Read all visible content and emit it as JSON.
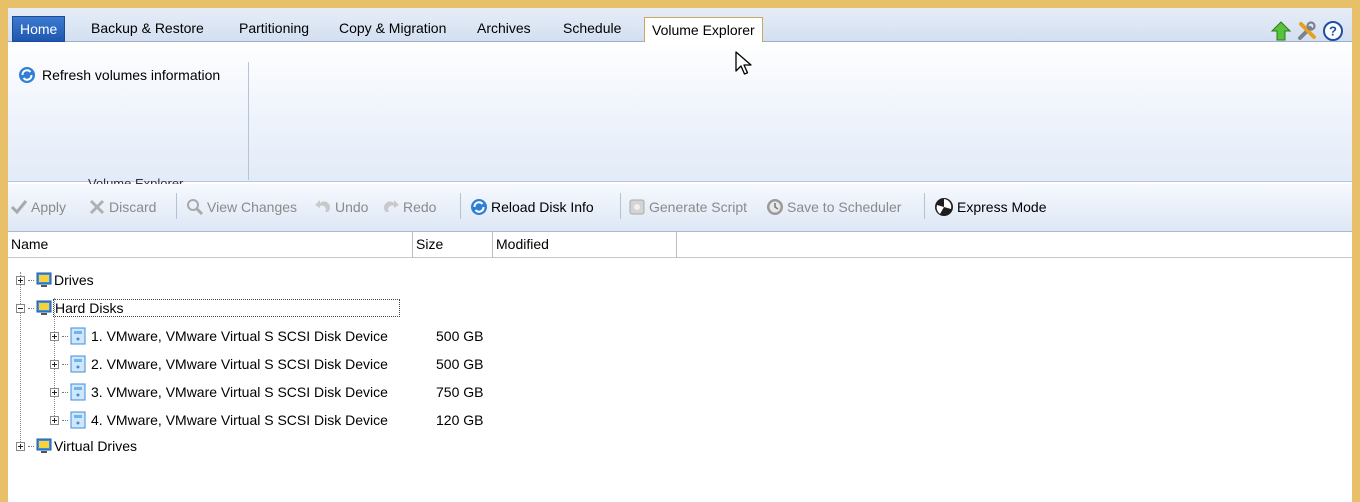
{
  "tabs": [
    "Home",
    "Backup & Restore",
    "Partitioning",
    "Copy & Migration",
    "Archives",
    "Schedule",
    "Volume Explorer"
  ],
  "ribbon": {
    "refresh_label": "Refresh volumes information",
    "group_label": "Volume Explorer"
  },
  "toolbar": {
    "apply": "Apply",
    "discard": "Discard",
    "view_changes": "View Changes",
    "undo": "Undo",
    "redo": "Redo",
    "reload": "Reload Disk Info",
    "generate_script": "Generate Script",
    "save_scheduler": "Save to Scheduler",
    "express": "Express Mode"
  },
  "columns": [
    "Name",
    "Size",
    "Modified"
  ],
  "tree": {
    "drives": "Drives",
    "hard_disks": "Hard Disks",
    "disks": [
      {
        "name": "1. VMware, VMware Virtual S SCSI Disk Device",
        "size": "500 GB"
      },
      {
        "name": "2. VMware, VMware Virtual S SCSI Disk Device",
        "size": "500 GB"
      },
      {
        "name": "3. VMware, VMware Virtual S SCSI Disk Device",
        "size": "750 GB"
      },
      {
        "name": "4. VMware, VMware Virtual S SCSI Disk Device",
        "size": "120 GB"
      }
    ],
    "virtual_drives": "Virtual Drives"
  }
}
